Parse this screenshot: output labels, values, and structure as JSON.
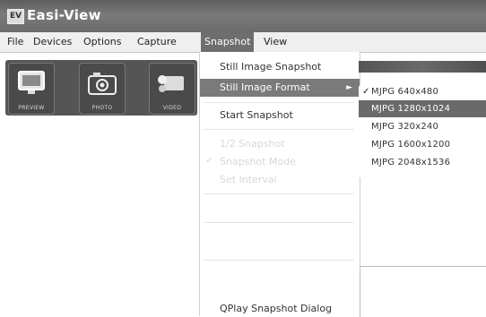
{
  "window": {
    "title": "Easi-View",
    "icon_text": "EV"
  },
  "menubar": {
    "items": [
      {
        "label": "File",
        "active": false
      },
      {
        "label": "Devices",
        "active": false
      },
      {
        "label": "Options",
        "active": false
      },
      {
        "label": "Capture",
        "active": false
      },
      {
        "label": "Snapshot",
        "active": true
      },
      {
        "label": "View",
        "active": false
      }
    ]
  },
  "toolbar": {
    "buttons": [
      {
        "label": "PREVIEW",
        "icon": "monitor-icon"
      },
      {
        "label": "PHOTO",
        "icon": "camera-icon"
      },
      {
        "label": "VIDEO",
        "icon": "video-camera-icon"
      }
    ]
  },
  "snapshot_menu": {
    "still_image_snapshot": "Still Image Snapshot",
    "still_image_format": "Still Image Format",
    "start_snapshot": "Start Snapshot",
    "disabled_1": "1/2 Snapshot",
    "disabled_2": "Snapshot Mode",
    "disabled_3": "Set Interval",
    "qplay_dialog": "QPlay Snapshot Dialog"
  },
  "format_submenu": {
    "items": [
      {
        "label": "MJPG 640x480",
        "checked": true
      },
      {
        "label": "MJPG 1280x1024",
        "highlighted": true
      },
      {
        "label": "MJPG 320x240"
      },
      {
        "label": "MJPG 1600x1200"
      },
      {
        "label": "MJPG 2048x1536"
      }
    ]
  },
  "colors": {
    "titlebar": "#6b6b6b",
    "highlight": "#7a7a7a",
    "menu_bg": "#efefef"
  }
}
